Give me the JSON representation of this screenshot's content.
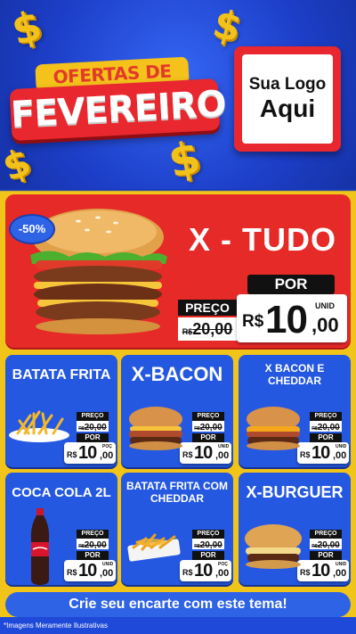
{
  "header": {
    "title_top": "OFERTAS DE",
    "title_main": "FEVEREIRO",
    "logo_line1": "Sua Logo",
    "logo_line2": "Aqui",
    "accent_red": "#e8282e",
    "accent_yellow": "#f3c21a",
    "accent_blue": "#2558e0"
  },
  "hero": {
    "title": "X - TUDO",
    "badge": "-50%",
    "old_label": "PREÇO",
    "old_currency": "R$",
    "old_value": "20,00",
    "por_label": "POR",
    "unit": "UNID",
    "currency": "R$",
    "price_int": "10",
    "price_cents": ",00"
  },
  "products": [
    {
      "name": "BATATA FRITA",
      "old_label": "PREÇO",
      "old_currency": "R$",
      "old_value": "20,00",
      "por_label": "POR",
      "unit": "POÇ",
      "currency": "R$",
      "price_int": "10",
      "price_cents": ",00"
    },
    {
      "name": "X-BACON",
      "old_label": "PREÇO",
      "old_currency": "R$",
      "old_value": "20,00",
      "por_label": "POR",
      "unit": "UNID",
      "currency": "R$",
      "price_int": "10",
      "price_cents": ",00"
    },
    {
      "name": "X BACON E CHEDDAR",
      "old_label": "PREÇO",
      "old_currency": "R$",
      "old_value": "20,00",
      "por_label": "POR",
      "unit": "UNID",
      "currency": "R$",
      "price_int": "10",
      "price_cents": ",00"
    },
    {
      "name": "COCA COLA 2L",
      "old_label": "PREÇO",
      "old_currency": "R$",
      "old_value": "20,00",
      "por_label": "POR",
      "unit": "UNID",
      "currency": "R$",
      "price_int": "10",
      "price_cents": ",00"
    },
    {
      "name": "BATATA FRITA COM CHEDDAR",
      "old_label": "PREÇO",
      "old_currency": "R$",
      "old_value": "20,00",
      "por_label": "POR",
      "unit": "POÇ",
      "currency": "R$",
      "price_int": "10",
      "price_cents": ",00"
    },
    {
      "name": "X-BURGUER",
      "old_label": "PREÇO",
      "old_currency": "R$",
      "old_value": "20,00",
      "por_label": "POR",
      "unit": "UNID",
      "currency": "R$",
      "price_int": "10",
      "price_cents": ",00"
    }
  ],
  "footer": {
    "cta": "Crie seu encarte com este tema!",
    "disclaimer": "*Imagens Meramente Ilustrativas"
  },
  "icons": {
    "dollar": "$"
  }
}
